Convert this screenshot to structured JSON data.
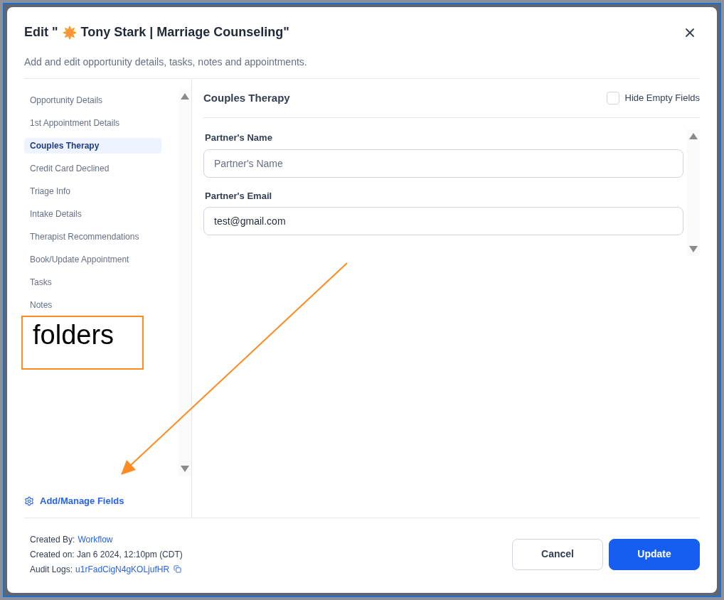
{
  "dialog": {
    "title_prefix": "Edit \"",
    "title_rest": "Tony Stark | Marriage Counseling\"",
    "subtitle": "Add and edit opportunity details, tasks, notes and appointments."
  },
  "sidebar": {
    "items": [
      {
        "label": "Opportunity Details",
        "selected": false
      },
      {
        "label": "1st Appointment Details",
        "selected": false
      },
      {
        "label": "Couples Therapy",
        "selected": true
      },
      {
        "label": "Credit Card Declined",
        "selected": false
      },
      {
        "label": "Triage Info",
        "selected": false
      },
      {
        "label": "Intake Details",
        "selected": false
      },
      {
        "label": "Therapist Recommendations",
        "selected": false
      },
      {
        "label": "Book/Update Appointment",
        "selected": false
      },
      {
        "label": "Tasks",
        "selected": false
      },
      {
        "label": "Notes",
        "selected": false
      }
    ],
    "manage_link": "Add/Manage Fields"
  },
  "section": {
    "title": "Couples Therapy",
    "hide_empty": {
      "label": "Hide Empty Fields",
      "checked": false
    },
    "fields": [
      {
        "label": "Partner's Name",
        "placeholder": "Partner's Name"
      },
      {
        "label": "Partner's Email",
        "value": "test@gmail.com"
      }
    ]
  },
  "footer": {
    "created_by_label": "Created By:",
    "created_by": "Workflow",
    "created_on": "Created on: Jan 6 2024, 12:10pm (CDT)",
    "audit_label": "Audit Logs:",
    "audit_id": "u1rFadCigN4gKOLjufHR",
    "buttons": [
      {
        "label": "Cancel",
        "kind": "secondary"
      },
      {
        "label": "Update",
        "kind": "primary"
      }
    ]
  },
  "annotation": {
    "label": "folders"
  }
}
